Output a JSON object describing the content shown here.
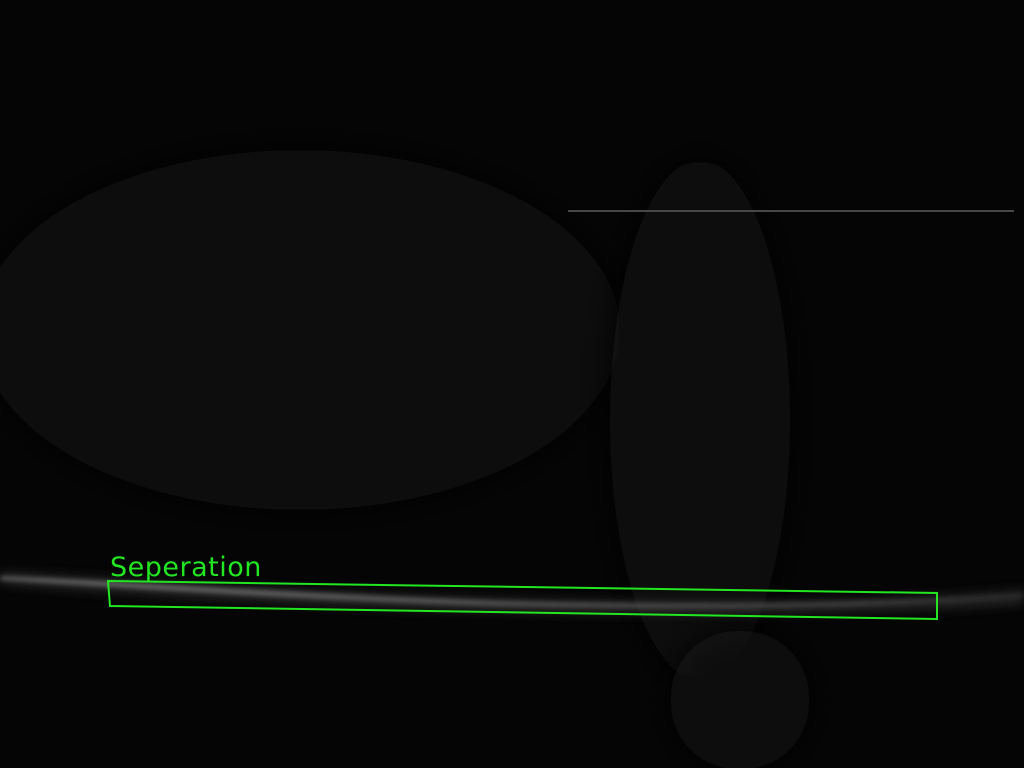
{
  "annotation": {
    "label": "Seperation",
    "color": "#22e622"
  },
  "colors": {
    "background": "#050505",
    "streak": "#6a6a6a",
    "rule": "#4a4a4a"
  }
}
